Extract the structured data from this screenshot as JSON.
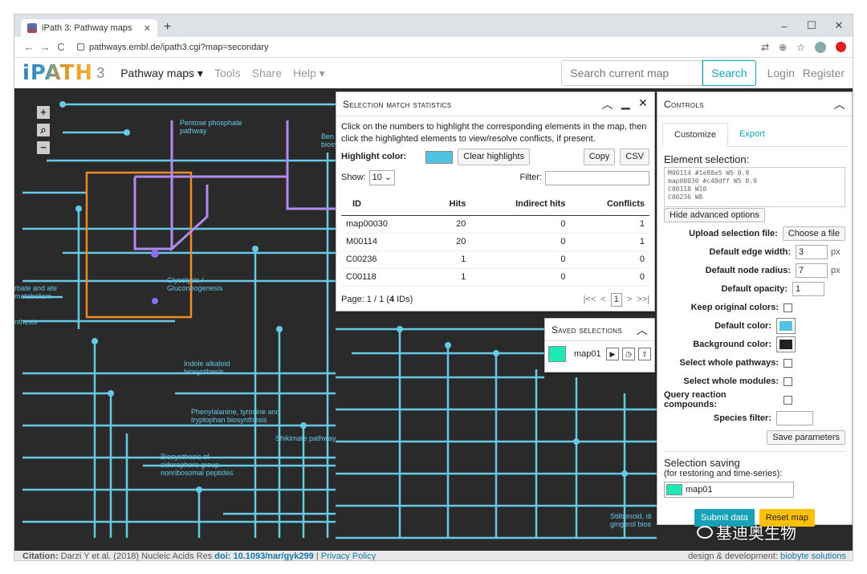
{
  "browser": {
    "tab_title": "iPath 3: Pathway maps",
    "new_tab": "+",
    "url": "pathways.embl.de/ipath3.cgi?map=secondary"
  },
  "site": {
    "logo": "iPATH",
    "logo_version": "3",
    "menu": [
      "Pathway maps ▾",
      "Tools",
      "Share",
      "Help ▾"
    ],
    "search_placeholder": "Search current map",
    "search_button": "Search",
    "login": "Login",
    "register": "Register"
  },
  "map_labels": [
    "Pentose phosphate pathway",
    "Ben biosy",
    "Glycolysis / Gluconeogenesis",
    "rbate and ate metabolism",
    "nthesis",
    "Indole alkaloid biosynthesis",
    "Phenylalanine, tyrosine and tryptophan biosynthesis",
    "Shikimate pathway",
    "Biosynthesis of siderophore group nonribosomal peptides",
    "Stilbenoid, di gingerol bios"
  ],
  "stats": {
    "title": "Selection match statistics",
    "intro": "Click on the numbers to highlight the corresponding elements in the map, then click the highlighted elements to view/resolve conflicts, if present.",
    "highlight_label": "Highlight color:",
    "highlight_color": "#4fc3e0",
    "clear": "Clear highlights",
    "copy": "Copy",
    "csv": "CSV",
    "show_label": "Show:",
    "show_value": "10",
    "filter_label": "Filter:",
    "columns": [
      "ID",
      "Hits",
      "Indirect hits",
      "Conflicts"
    ],
    "rows": [
      [
        "map00030",
        "20",
        "0",
        "1"
      ],
      [
        "M00114",
        "20",
        "0",
        "1"
      ],
      [
        "C00236",
        "1",
        "0",
        "0"
      ],
      [
        "C00118",
        "1",
        "0",
        "0"
      ]
    ],
    "page_prefix": "Page: 1 / 1 (",
    "page_count": "4",
    "page_suffix": " IDs)",
    "pager": [
      "|<<",
      "<",
      "1",
      ">",
      ">>|"
    ]
  },
  "saved": {
    "title": "Saved selections",
    "item": "map01",
    "item_color": "#1de9b6"
  },
  "controls": {
    "title": "Controls",
    "tabs": [
      "Customize",
      "Export"
    ],
    "element_selection": "Element selection:",
    "code_lines": [
      "M00114 #1e88e5 W5 0.9",
      "map00030 #c48dff W5 0.9",
      "C00118 W10",
      "C00236 W8"
    ],
    "hide_advanced": "Hide advanced options",
    "upload_label": "Upload selection file:",
    "upload_btn": "Choose a file",
    "edge_width_label": "Default edge width:",
    "edge_width": "3",
    "node_radius_label": "Default node radius:",
    "node_radius": "7",
    "opacity_label": "Default opacity:",
    "opacity": "1",
    "unit": "px",
    "keep_colors": "Keep original colors:",
    "default_color_label": "Default color:",
    "default_color": "#4fc3e0",
    "bg_color_label": "Background color:",
    "bg_color": "#222222",
    "whole_pathways": "Select whole pathways:",
    "whole_modules": "Select whole modules:",
    "query_reaction": "Query reaction compounds:",
    "species_filter": "Species filter:",
    "save_params": "Save parameters",
    "saving_title": "Selection saving",
    "saving_sub": "(for restoring and time-series):",
    "saving_value": "map01",
    "submit": "Submit data",
    "reset": "Reset map"
  },
  "footer": {
    "citation_label": "Citation:",
    "citation": "Darzi Y et al. (2018) Nucleic Acids Res",
    "doi": "doi: 10.1093/nar/gyk299",
    "privacy": "Privacy Policy",
    "credit": "design & development:",
    "credit_link": "biobyte solutions"
  },
  "watermark": "基迪奥生物"
}
